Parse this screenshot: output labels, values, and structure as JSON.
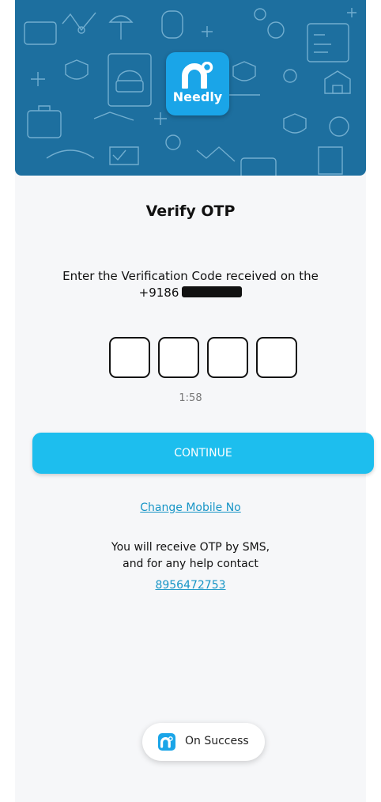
{
  "header": {
    "logo_text": "Needly",
    "logo_icon": "needly-logo-icon"
  },
  "verify": {
    "title": "Verify OTP",
    "instruction": "Enter the Verification Code received on the",
    "phone_prefix": "+9186",
    "otp_digits": [
      "",
      "",
      "",
      ""
    ],
    "timer": "1:58"
  },
  "actions": {
    "continue_label": "CONTINUE",
    "change_mobile_label": "Change Mobile No"
  },
  "help": {
    "line1": "You will receive OTP by SMS,",
    "line2": "and for any help contact",
    "phone": "8956472753"
  },
  "toast": {
    "text": "On Success",
    "icon": "needly-logo-icon"
  },
  "colors": {
    "header_bg": "#1d6f9f",
    "accent": "#1dbeee",
    "link": "#1795c6"
  }
}
